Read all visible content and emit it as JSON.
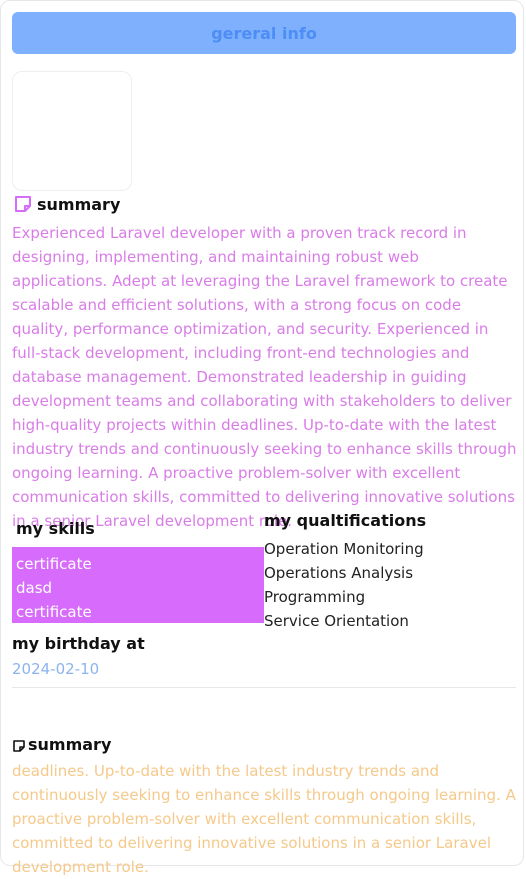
{
  "header": {
    "button_label": "gereral info"
  },
  "summary": {
    "title": "summary",
    "text": "Experienced Laravel developer with a proven track record in designing, implementing, and maintaining robust web applications. Adept at leveraging the Laravel framework to create scalable and efficient solutions, with a strong focus on code quality, performance optimization, and security. Experienced in full-stack development, including front-end technologies and database management. Demonstrated leadership in guiding development teams and collaborating with stakeholders to deliver high-quality projects within deadlines. Up-to-date with the latest industry trends and continuously seeking to enhance skills through ongoing learning. A proactive problem-solver with excellent communication skills, committed to delivering innovative solutions in a senior Laravel development role.",
    "icon": "note-icon",
    "icon_color": "#d76bfb"
  },
  "skills": {
    "title": "my skills",
    "items": [
      "certificate",
      "dasd",
      "certificate"
    ],
    "box_color": "#d76bfb"
  },
  "qualifications": {
    "title": "my qualtifications",
    "items": [
      "Operation Monitoring",
      "Operations Analysis",
      "Programming",
      "Service Orientation"
    ]
  },
  "birthday": {
    "title": "my birthday at",
    "value": "2024-02-10"
  },
  "summary2": {
    "title": "summary",
    "text": "deadlines. Up-to-date with the latest industry trends and continuously seeking to enhance skills through ongoing learning. A proactive problem-solver with excellent communication skills, committed to delivering innovative solutions in a senior Laravel development role.",
    "icon": "note-icon"
  },
  "colors": {
    "header_bg": "#7fb0fd",
    "summary_text": "#d97ce8",
    "birthday_text": "#8cb3ee",
    "summary2_text": "#f5c98a"
  }
}
